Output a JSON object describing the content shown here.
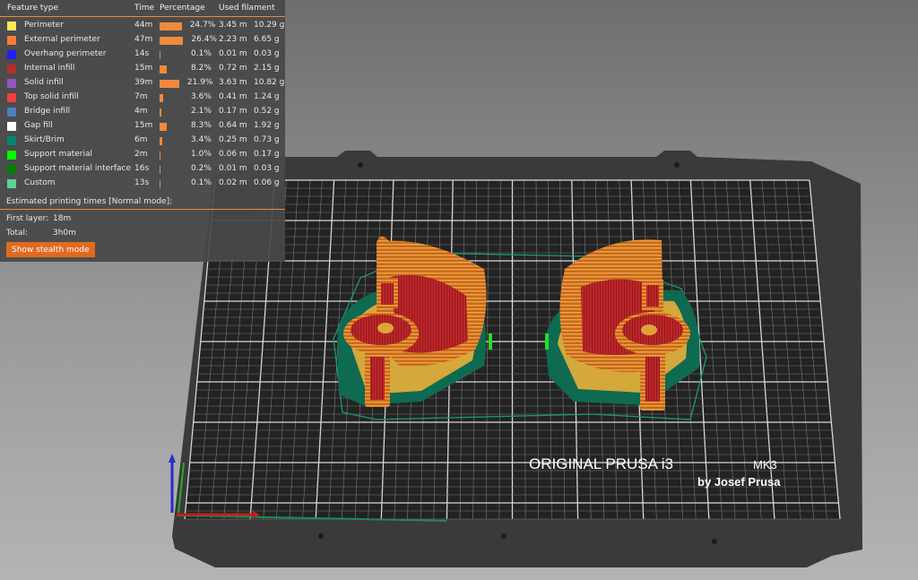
{
  "legend": {
    "headers": {
      "feature": "Feature type",
      "time": "Time",
      "percentage": "Percentage",
      "filament": "Used filament"
    },
    "rows": [
      {
        "name": "Perimeter",
        "color": "#ffe65a",
        "time": "44m",
        "percent": "24.7%",
        "pct": 24.7,
        "length": "3.45 m",
        "weight": "10.29 g"
      },
      {
        "name": "External perimeter",
        "color": "#ff7d38",
        "time": "47m",
        "percent": "26.4%",
        "pct": 26.4,
        "length": "2.23 m",
        "weight": "6.65 g"
      },
      {
        "name": "Overhang perimeter",
        "color": "#1f1fff",
        "time": "14s",
        "percent": "0.1%",
        "pct": 0.1,
        "length": "0.01 m",
        "weight": "0.03 g"
      },
      {
        "name": "Internal infill",
        "color": "#b03029",
        "time": "15m",
        "percent": "8.2%",
        "pct": 8.2,
        "length": "0.72 m",
        "weight": "2.15 g"
      },
      {
        "name": "Solid infill",
        "color": "#9654cc",
        "time": "39m",
        "percent": "21.9%",
        "pct": 21.9,
        "length": "3.63 m",
        "weight": "10.82 g"
      },
      {
        "name": "Top solid infill",
        "color": "#f04040",
        "time": "7m",
        "percent": "3.6%",
        "pct": 3.6,
        "length": "0.41 m",
        "weight": "1.24 g"
      },
      {
        "name": "Bridge infill",
        "color": "#4d80ba",
        "time": "4m",
        "percent": "2.1%",
        "pct": 2.1,
        "length": "0.17 m",
        "weight": "0.52 g"
      },
      {
        "name": "Gap fill",
        "color": "#ffffff",
        "time": "15m",
        "percent": "8.3%",
        "pct": 8.3,
        "length": "0.64 m",
        "weight": "1.92 g"
      },
      {
        "name": "Skirt/Brim",
        "color": "#00876e",
        "time": "6m",
        "percent": "3.4%",
        "pct": 3.4,
        "length": "0.25 m",
        "weight": "0.73 g"
      },
      {
        "name": "Support material",
        "color": "#00ff00",
        "time": "2m",
        "percent": "1.0%",
        "pct": 1.0,
        "length": "0.06 m",
        "weight": "0.17 g"
      },
      {
        "name": "Support material interface",
        "color": "#008000",
        "time": "16s",
        "percent": "0.2%",
        "pct": 0.2,
        "length": "0.01 m",
        "weight": "0.03 g"
      },
      {
        "name": "Custom",
        "color": "#5ed194",
        "time": "13s",
        "percent": "0.1%",
        "pct": 0.1,
        "length": "0.02 m",
        "weight": "0.06 g"
      }
    ],
    "estimated_title": "Estimated printing times [Normal mode]:",
    "first_layer_label": "First layer:",
    "first_layer_value": "18m",
    "total_label": "Total:",
    "total_value": "3h0m",
    "stealth_button": "Show stealth mode"
  },
  "bed": {
    "brand_line": "ORIGINAL PRUSA i3",
    "model": "MK3",
    "by_line": "by Josef Prusa"
  }
}
